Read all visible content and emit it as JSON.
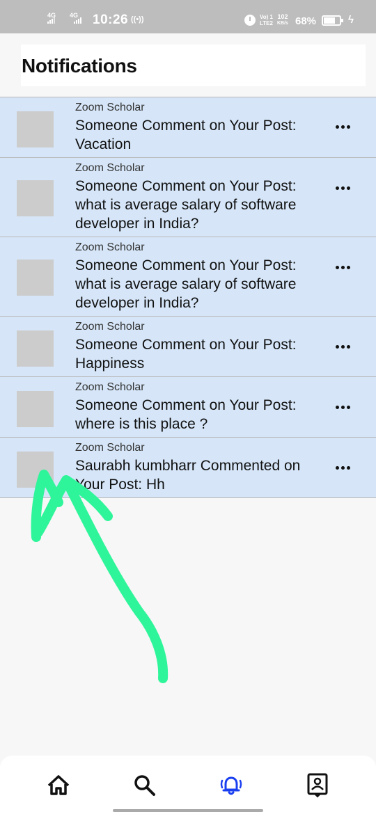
{
  "status_bar": {
    "network_left": "4G",
    "network_right": "4G",
    "time": "10:26",
    "lte_line1": "Vo) 1",
    "lte_line2": "LTE2",
    "speed_value": "102",
    "speed_unit": "KB/s",
    "battery": "68%",
    "icons": [
      "hotspot-icon",
      "alarm-icon",
      "battery-icon",
      "charging-icon"
    ]
  },
  "header": {
    "title": "Notifications"
  },
  "notifications": [
    {
      "sender": "Zoom Scholar",
      "message": "Someone Comment on Your Post: Vacation"
    },
    {
      "sender": "Zoom Scholar",
      "message": "Someone Comment on Your Post: what is average salary of software developer in India?"
    },
    {
      "sender": "Zoom Scholar",
      "message": "Someone Comment on Your Post: what is average salary of software developer in India?"
    },
    {
      "sender": "Zoom Scholar",
      "message": "Someone Comment on Your Post: Happiness"
    },
    {
      "sender": "Zoom Scholar",
      "message": "Someone Comment on Your Post: where is this place ?"
    },
    {
      "sender": "Zoom Scholar",
      "message": "Saurabh kumbharr Commented on Your Post: Hh"
    }
  ],
  "bottom_nav": {
    "items": [
      "home-icon",
      "search-icon",
      "notifications-bell-icon",
      "profile-icon"
    ],
    "active": "notifications-bell-icon",
    "active_color": "#1a3ff0",
    "icon_color": "#111111"
  },
  "colors": {
    "notification_bg": "#d6e6f8",
    "status_bar_bg": "#bdbdbd",
    "annotation_arrow": "#2ff59a"
  }
}
